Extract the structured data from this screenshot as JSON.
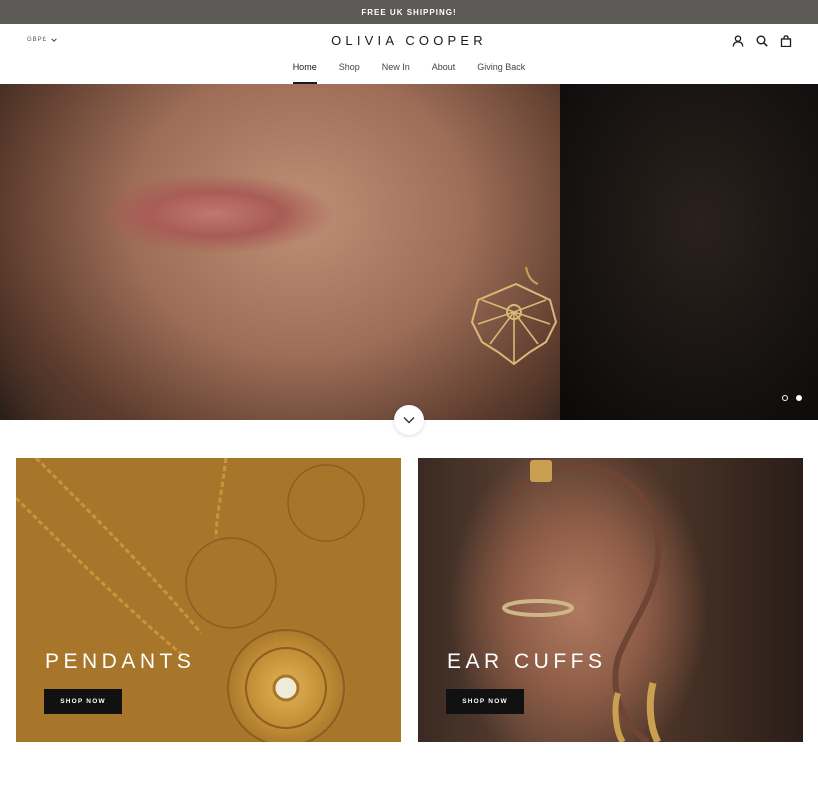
{
  "announcement": {
    "text": "FREE UK SHIPPING!"
  },
  "header": {
    "currency": "GBP£",
    "logo": "OLIVIA COOPER",
    "icons": [
      "account-icon",
      "search-icon",
      "cart-icon"
    ]
  },
  "nav": {
    "items": [
      {
        "label": "Home",
        "active": true
      },
      {
        "label": "Shop"
      },
      {
        "label": "New In"
      },
      {
        "label": "About"
      },
      {
        "label": "Giving Back"
      }
    ]
  },
  "hero": {
    "slide_count": 2,
    "current_slide": 2
  },
  "collections": [
    {
      "title": "PENDANTS",
      "button": "SHOP NOW"
    },
    {
      "title": "EAR CUFFS",
      "button": "SHOP NOW"
    }
  ],
  "colors": {
    "announcement_bg": "#5c5a57",
    "button_bg": "#111111",
    "text": "#1c1b1b"
  }
}
